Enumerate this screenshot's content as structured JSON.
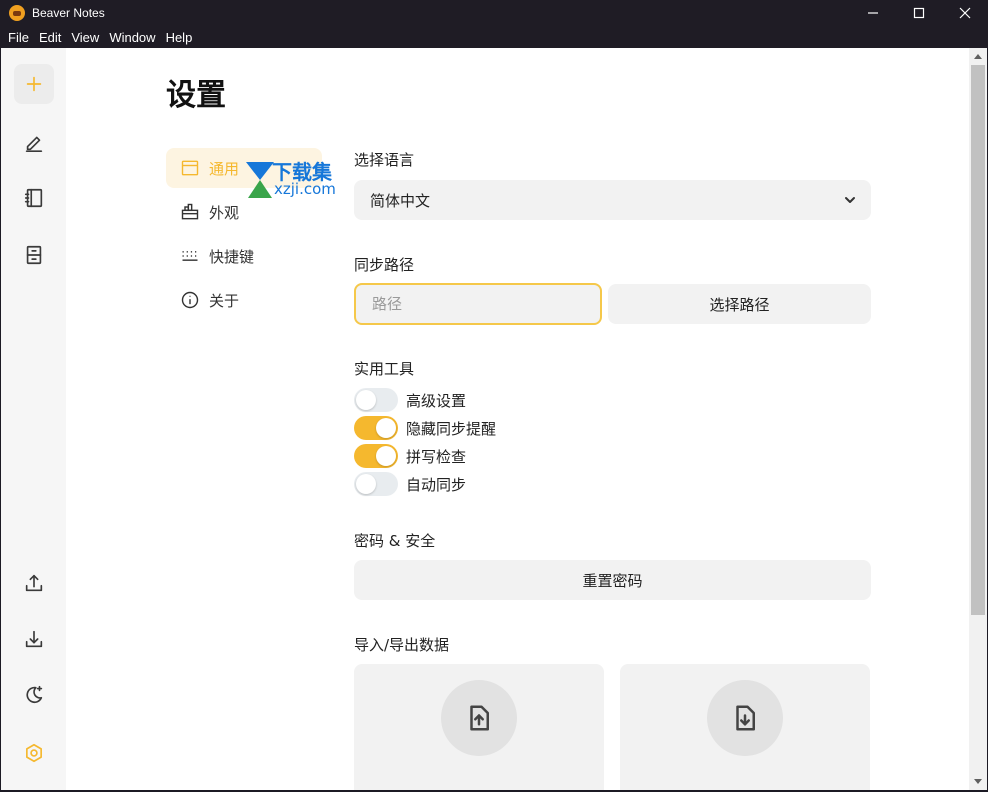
{
  "window": {
    "title": "Beaver Notes"
  },
  "menubar": {
    "items": [
      "File",
      "Edit",
      "View",
      "Window",
      "Help"
    ]
  },
  "sidebar": {
    "top": [
      "add-note",
      "edit",
      "notebook",
      "archive"
    ],
    "bottom": [
      "export",
      "import",
      "dark-mode",
      "settings"
    ]
  },
  "page": {
    "title": "设置"
  },
  "settings_nav": [
    {
      "label": "通用",
      "icon": "layout-icon",
      "active": true
    },
    {
      "label": "外观",
      "icon": "brush-icon"
    },
    {
      "label": "快捷键",
      "icon": "keyboard-icon"
    },
    {
      "label": "关于",
      "icon": "info-icon"
    }
  ],
  "watermark": {
    "text": "下载集",
    "sub": "xzji.com"
  },
  "language": {
    "label": "选择语言",
    "value": "简体中文"
  },
  "sync": {
    "label": "同步路径",
    "placeholder": "路径",
    "button": "选择路径"
  },
  "tools": {
    "label": "实用工具",
    "toggles": [
      {
        "label": "高级设置",
        "on": false
      },
      {
        "label": "隐藏同步提醒",
        "on": true
      },
      {
        "label": "拼写检查",
        "on": true
      },
      {
        "label": "自动同步",
        "on": false
      }
    ]
  },
  "security": {
    "label": "密码 & 安全",
    "button": "重置密码"
  },
  "data": {
    "label": "导入/导出数据"
  },
  "colors": {
    "accent": "#f5b82e",
    "titlebar": "#1f1c25"
  }
}
